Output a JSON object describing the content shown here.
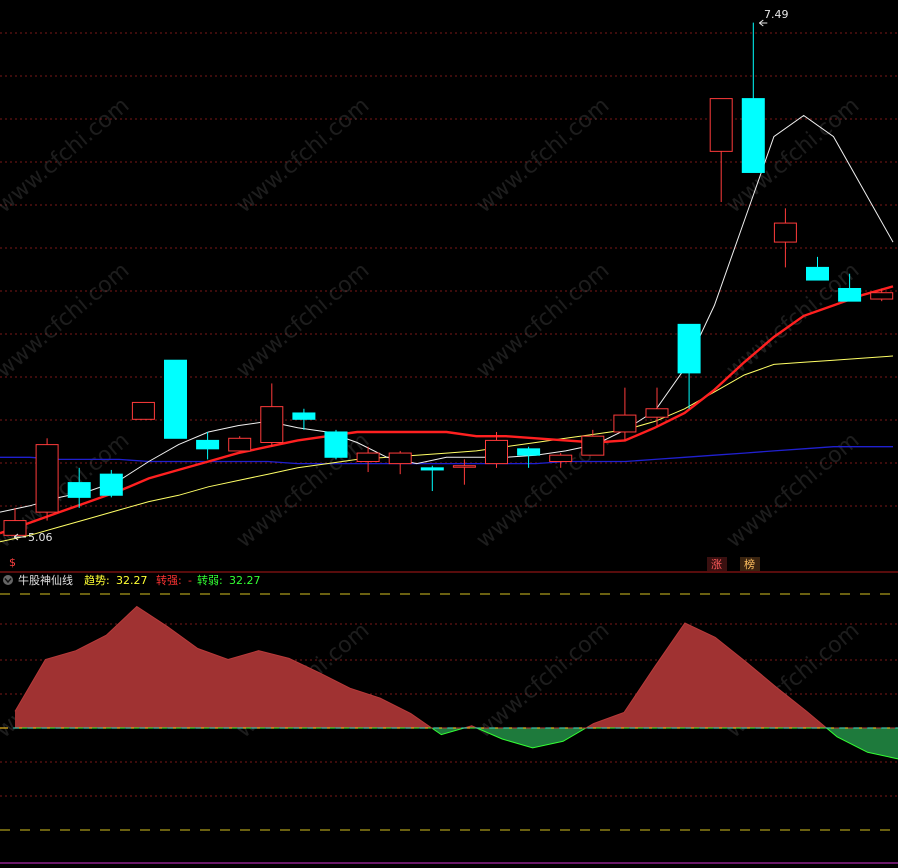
{
  "chart_data": [
    {
      "type": "candlestick",
      "high_label": "7.49",
      "low_label": "5.06",
      "markers": [
        "涨",
        "榜"
      ],
      "small_marker": "$",
      "ylim": [
        5.0,
        7.55
      ],
      "bull_color": "#ff3b3b",
      "bear_color": "#00ffff",
      "grid": true,
      "candles": [
        {
          "o": 5.06,
          "h": 5.19,
          "l": 5.06,
          "c": 5.13
        },
        {
          "o": 5.17,
          "h": 5.52,
          "l": 5.13,
          "c": 5.49
        },
        {
          "o": 5.31,
          "h": 5.38,
          "l": 5.19,
          "c": 5.24
        },
        {
          "o": 5.35,
          "h": 5.37,
          "l": 5.24,
          "c": 5.25
        },
        {
          "o": 5.61,
          "h": 5.61,
          "l": 5.61,
          "c": 5.69
        },
        {
          "o": 5.89,
          "h": 5.89,
          "l": 5.52,
          "c": 5.52
        },
        {
          "o": 5.51,
          "h": 5.55,
          "l": 5.42,
          "c": 5.47
        },
        {
          "o": 5.46,
          "h": 5.53,
          "l": 5.46,
          "c": 5.52
        },
        {
          "o": 5.5,
          "h": 5.78,
          "l": 5.48,
          "c": 5.67
        },
        {
          "o": 5.64,
          "h": 5.66,
          "l": 5.56,
          "c": 5.61
        },
        {
          "o": 5.55,
          "h": 5.56,
          "l": 5.42,
          "c": 5.43
        },
        {
          "o": 5.41,
          "h": 5.48,
          "l": 5.36,
          "c": 5.45
        },
        {
          "o": 5.4,
          "h": 5.46,
          "l": 5.35,
          "c": 5.45
        },
        {
          "o": 5.38,
          "h": 5.39,
          "l": 5.27,
          "c": 5.37
        },
        {
          "o": 5.39,
          "h": 5.42,
          "l": 5.3,
          "c": 5.39
        },
        {
          "o": 5.4,
          "h": 5.55,
          "l": 5.38,
          "c": 5.51
        },
        {
          "o": 5.47,
          "h": 5.48,
          "l": 5.38,
          "c": 5.44
        },
        {
          "o": 5.41,
          "h": 5.45,
          "l": 5.38,
          "c": 5.44
        },
        {
          "o": 5.44,
          "h": 5.56,
          "l": 5.44,
          "c": 5.53
        },
        {
          "o": 5.55,
          "h": 5.76,
          "l": 5.51,
          "c": 5.63
        },
        {
          "o": 5.62,
          "h": 5.76,
          "l": 5.58,
          "c": 5.66
        },
        {
          "o": 6.06,
          "h": 6.06,
          "l": 5.66,
          "c": 5.83
        },
        {
          "o": 6.88,
          "h": 6.88,
          "l": 6.64,
          "c": 7.13
        },
        {
          "o": 7.13,
          "h": 7.49,
          "l": 6.83,
          "c": 6.78
        },
        {
          "o": 6.45,
          "h": 6.61,
          "l": 6.33,
          "c": 6.54
        },
        {
          "o": 6.33,
          "h": 6.38,
          "l": 6.27,
          "c": 6.27
        },
        {
          "o": 6.23,
          "h": 6.3,
          "l": 6.17,
          "c": 6.17
        },
        {
          "o": 6.18,
          "h": 6.23,
          "l": 6.17,
          "c": 6.21
        }
      ],
      "ma_white": [
        5.17,
        5.2,
        5.24,
        5.27,
        5.32,
        5.41,
        5.49,
        5.55,
        5.58,
        5.6,
        5.57,
        5.55,
        5.5,
        5.43,
        5.4,
        5.43,
        5.43,
        5.43,
        5.44,
        5.46,
        5.49,
        5.56,
        5.65,
        5.85,
        6.15,
        6.55,
        6.95,
        7.05,
        6.95,
        6.7,
        6.45
      ],
      "ma_red": [
        5.07,
        5.12,
        5.17,
        5.22,
        5.27,
        5.33,
        5.37,
        5.41,
        5.45,
        5.48,
        5.51,
        5.53,
        5.55,
        5.55,
        5.55,
        5.55,
        5.53,
        5.53,
        5.52,
        5.51,
        5.5,
        5.51,
        5.57,
        5.64,
        5.75,
        5.88,
        6.0,
        6.1,
        6.15,
        6.2,
        6.24
      ],
      "ma_yellow": [
        5.03,
        5.06,
        5.1,
        5.14,
        5.18,
        5.22,
        5.25,
        5.29,
        5.32,
        5.35,
        5.38,
        5.4,
        5.42,
        5.43,
        5.44,
        5.45,
        5.46,
        5.48,
        5.5,
        5.52,
        5.54,
        5.56,
        5.6,
        5.66,
        5.74,
        5.82,
        5.87,
        5.88,
        5.89,
        5.9,
        5.91
      ],
      "ma_blue": [
        5.43,
        5.43,
        5.42,
        5.42,
        5.42,
        5.41,
        5.41,
        5.41,
        5.41,
        5.41,
        5.4,
        5.4,
        5.4,
        5.4,
        5.4,
        5.4,
        5.4,
        5.4,
        5.4,
        5.41,
        5.41,
        5.41,
        5.42,
        5.43,
        5.44,
        5.45,
        5.46,
        5.47,
        5.48,
        5.48,
        5.48
      ]
    },
    {
      "type": "area",
      "indicator_name": "牛股神仙线",
      "trend_label": "趋势:",
      "trend_value": "32.27",
      "strong_label": "转强:",
      "strong_value": "-",
      "weak_label": "转弱:",
      "weak_value": "32.27",
      "ylim": [
        -40,
        105
      ],
      "pos_color": "#a03232",
      "neg_color": "#1e7a3c",
      "values": [
        15,
        62,
        70,
        84,
        110,
        92,
        72,
        62,
        70,
        63,
        50,
        36,
        27,
        13,
        -6,
        2,
        -10,
        -18,
        -12,
        4,
        14,
        55,
        95,
        82,
        60,
        37,
        15,
        -8,
        -22,
        -28
      ]
    }
  ],
  "watermark": "www.cfchi.com"
}
